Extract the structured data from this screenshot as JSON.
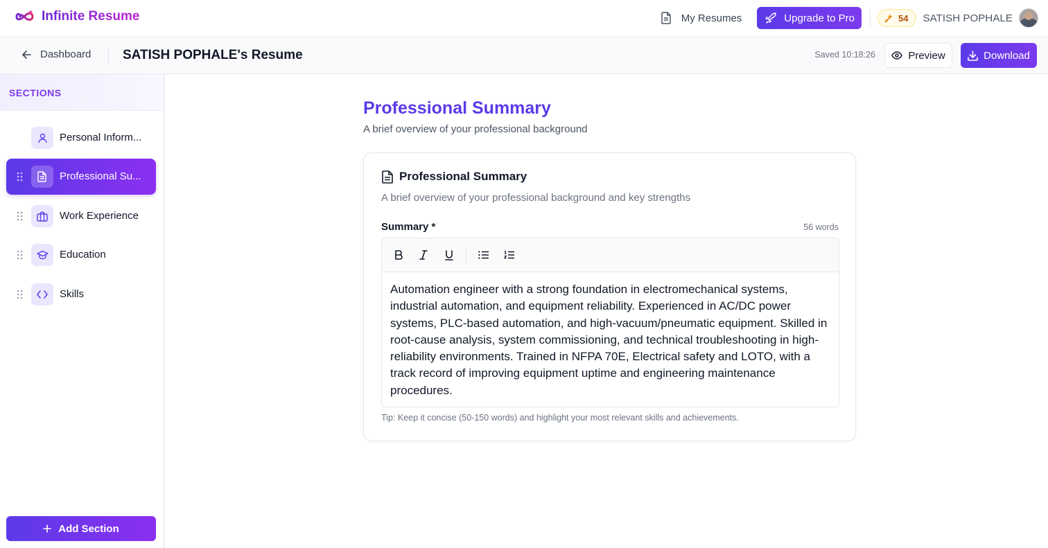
{
  "brand": {
    "name": "Infinite Resume"
  },
  "nav": {
    "my_resumes": "My Resumes",
    "upgrade": "Upgrade to Pro",
    "credits": "54",
    "username": "SATISH POPHALE"
  },
  "subheader": {
    "back_label": "Dashboard",
    "resume_title": "SATISH POPHALE's Resume",
    "saved_status": "Saved 10:18:26",
    "preview_label": "Preview",
    "download_label": "Download"
  },
  "sidebar": {
    "heading": "SECTIONS",
    "items": [
      {
        "label": "Personal Inform...",
        "icon": "user-icon",
        "active": false,
        "draggable": false
      },
      {
        "label": "Professional Su...",
        "icon": "document-icon",
        "active": true,
        "draggable": true
      },
      {
        "label": "Work Experience",
        "icon": "briefcase-icon",
        "active": false,
        "draggable": true
      },
      {
        "label": "Education",
        "icon": "graduation-cap-icon",
        "active": false,
        "draggable": true
      },
      {
        "label": "Skills",
        "icon": "code-icon",
        "active": false,
        "draggable": true
      }
    ],
    "add_section": "Add Section"
  },
  "main": {
    "title": "Professional Summary",
    "subtitle": "A brief overview of your professional background",
    "card": {
      "title": "Professional Summary",
      "subtitle": "A brief overview of your professional background and key strengths",
      "field_label": "Summary *",
      "word_count": "56 words",
      "summary_text": "Automation engineer with a strong foundation in electromechanical systems, industrial automation, and equipment reliability. Experienced in AC/DC power systems, PLC-based automation, and high-vacuum/pneumatic equipment. Skilled in root-cause analysis, system commissioning, and technical troubleshooting in high-reliability environments. Trained in NFPA 70E, Electrical safety and LOTO, with a track record of improving equipment uptime and engineering maintenance procedures.",
      "tip": "Tip: Keep it concise (50-150 words) and highlight your most relevant skills and achievements."
    }
  },
  "colors": {
    "accent": "#5b3ae8",
    "accent_end": "#8b2ff0",
    "credits_text": "#b45309"
  }
}
